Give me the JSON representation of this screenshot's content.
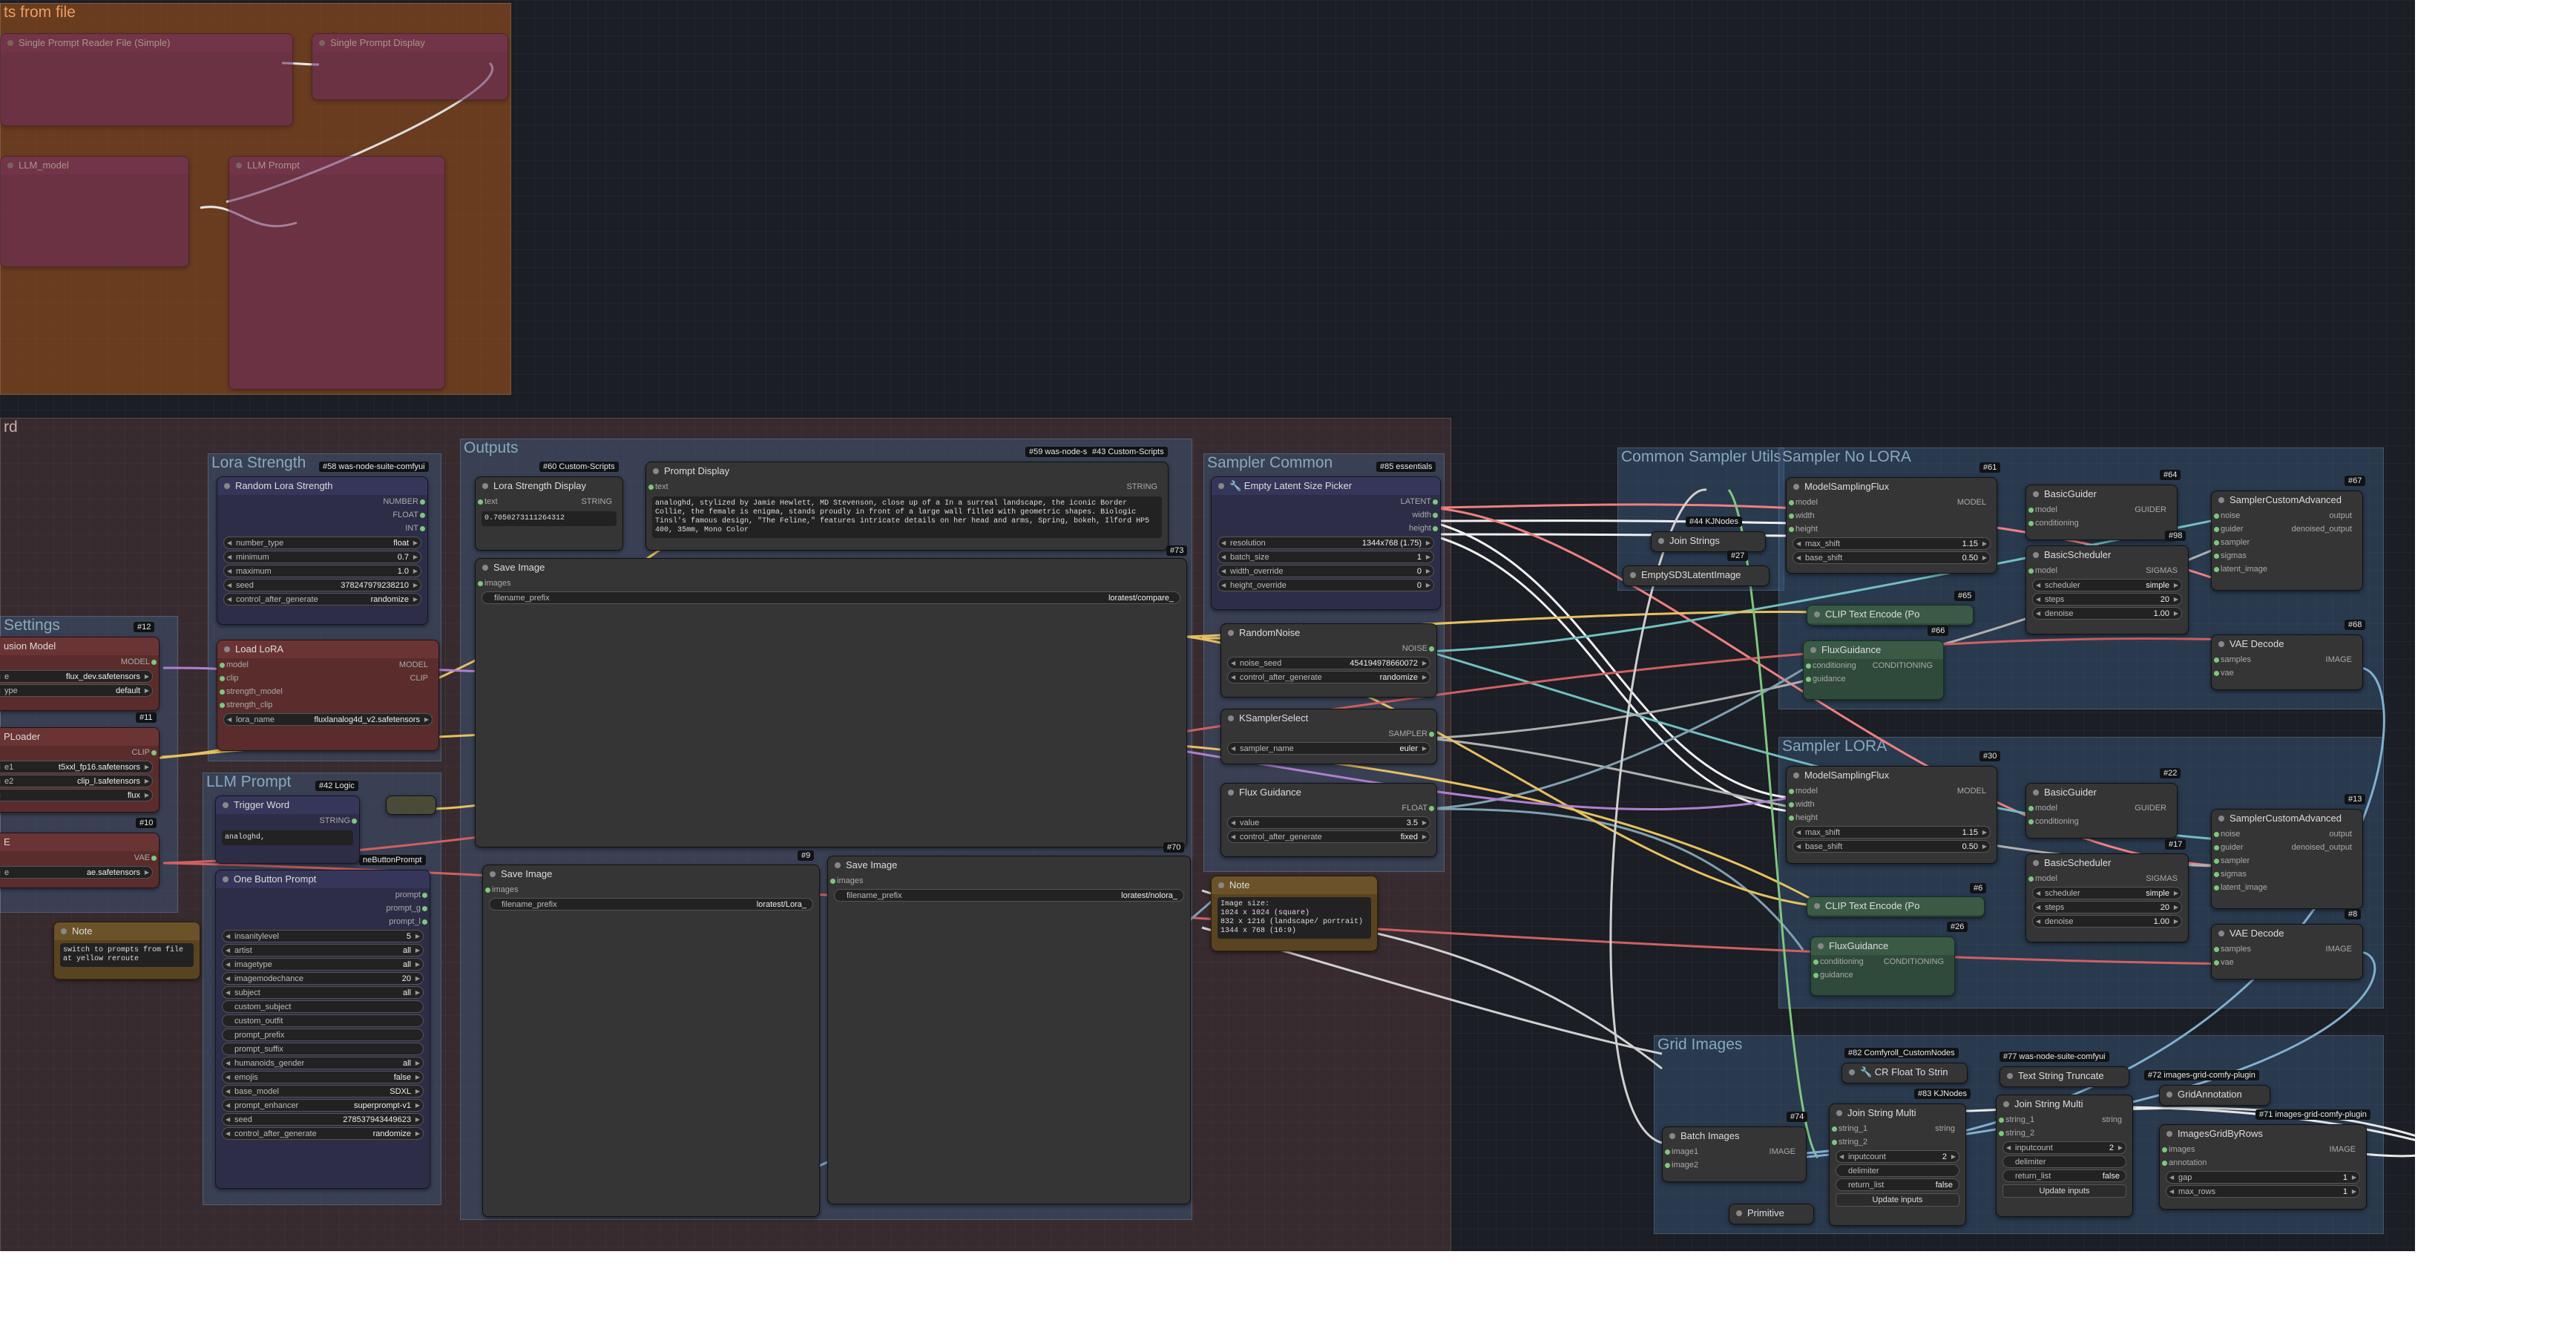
{
  "groups": {
    "prompts_file": "ts from file",
    "board": "rd",
    "lora_strength": "Lora Strength",
    "outputs": "Outputs",
    "sampler_common": "Sampler Common",
    "common_sampler_utils": "Common Sampler Utils",
    "sampler_no_lora": "Sampler No LORA",
    "sampler_lora": "Sampler LORA",
    "settings": "Settings",
    "llm_prompt": "LLM Prompt",
    "grid": "Grid Images"
  },
  "badges": {
    "b58": "#58 was-node-suite-comfyui",
    "b60": "#60 Custom-Scripts",
    "b59": "#59 was-node-s",
    "b43": "#43 Custom-Scripts",
    "b85": "#85 essentials",
    "b12": "#12",
    "b11": "#11",
    "b10": "#10",
    "b42": "#42 Logic",
    "b73": "#73",
    "b9": "#9",
    "b70": "#70",
    "b61": "#61",
    "b64": "#64",
    "b67": "#67",
    "b98": "#98",
    "b44": "#44 KJNodes",
    "b27": "#27",
    "b65": "#65",
    "b66": "#66",
    "b68": "#68",
    "b30": "#30",
    "b22": "#22",
    "b13": "#13",
    "b17": "#17",
    "b8": "#8",
    "b6": "#6",
    "b26": "#26",
    "b82": "#82 Comfyroll_CustomNodes",
    "b77": "#77 was-node-suite-comfyui",
    "b72": "#72 images-grid-comfy-plugin",
    "b83": "#83 KJNodes",
    "b71": "#71 images-grid-comfy-plugin",
    "b74": "#74"
  },
  "nodes": {
    "random_lora_strength": {
      "title": "Random Lora Strength",
      "outputs": [
        "NUMBER",
        "FLOAT",
        "INT"
      ],
      "widgets": [
        [
          "number_type",
          "float"
        ],
        [
          "minimum",
          "0.7"
        ],
        [
          "maximum",
          "1.0"
        ],
        [
          "seed",
          "378247979238210"
        ],
        [
          "control_after_generate",
          "randomize"
        ]
      ]
    },
    "load_lora": {
      "title": "Load LoRA",
      "inputs": [
        "model",
        "clip",
        "strength_model",
        "strength_clip"
      ],
      "outputs": [
        "MODEL",
        "CLIP"
      ],
      "widgets": [
        [
          "lora_name",
          "fluxlanalog4d_v2.safetensors"
        ]
      ]
    },
    "lora_strength_display": {
      "title": "Lora Strength Display",
      "input": "text",
      "output": "STRING",
      "value": "0.7050273111264312"
    },
    "prompt_display": {
      "title": "Prompt Display",
      "input": "text",
      "output": "STRING",
      "value": "analoghd, stylized by Jamie Hewlett, MD Stevenson, close up of a In a surreal landscape, the iconic Border Collie, the female is enigma, stands proudly in front of a large wall filled with geometric shapes. Biologic Tinsl's famous design, \"The Feline,\" features intricate details on her head and arms, Spring, bokeh, Ilford HP5 400, 35mm, Mono Color"
    },
    "save_image_top": {
      "title": "Save Image",
      "input": "images",
      "widget": [
        "filename_prefix",
        "loratest/compare_"
      ]
    },
    "save_image_left": {
      "title": "Save Image",
      "input": "images",
      "widget": [
        "filename_prefix",
        "loratest/Lora_"
      ]
    },
    "save_image_right": {
      "title": "Save Image",
      "input": "images",
      "widget": [
        "filename_prefix",
        "loratest/nolora_"
      ]
    },
    "empty_latent_picker": {
      "title": "🔧 Empty Latent Size Picker",
      "outputs": [
        "LATENT",
        "width",
        "height"
      ],
      "widgets": [
        [
          "resolution",
          "1344x768 (1.75)"
        ],
        [
          "batch_size",
          "1"
        ],
        [
          "width_override",
          "0"
        ],
        [
          "height_override",
          "0"
        ]
      ]
    },
    "random_noise": {
      "title": "RandomNoise",
      "output": "NOISE",
      "widgets": [
        [
          "noise_seed",
          "454194978660072"
        ],
        [
          "control_after_generate",
          "randomize"
        ]
      ]
    },
    "ksampler_select": {
      "title": "KSamplerSelect",
      "output": "SAMPLER",
      "widgets": [
        [
          "sampler_name",
          "euler"
        ]
      ]
    },
    "flux_guidance_float": {
      "title": "Flux Guidance",
      "output": "FLOAT",
      "widgets": [
        [
          "value",
          "3.5"
        ],
        [
          "control_after_generate",
          "fixed"
        ]
      ]
    },
    "note_sizes": {
      "title": "Note",
      "text": "Image size:\n1024 x 1024 (square)\n832 x 1216 (landscape/ portrait)\n1344 x 768 (16:9)"
    },
    "diffusion_model": {
      "title": "usion Model",
      "output": "MODEL",
      "widgets": [
        [
          "e",
          "flux_dev.safetensors"
        ],
        [
          "ype",
          "default"
        ]
      ]
    },
    "clip_loader": {
      "title": "PLoader",
      "output": "CLIP",
      "widgets": [
        [
          "e1",
          "t5xxl_fp16.safetensors"
        ],
        [
          "e2",
          "clip_l.safetensors"
        ],
        [
          "",
          "flux"
        ]
      ]
    },
    "vae_loader": {
      "title": "E",
      "output": "VAE",
      "widgets": [
        [
          "e",
          "ae.safetensors"
        ]
      ]
    },
    "trigger_word": {
      "title": "Trigger Word",
      "output": "STRING",
      "value": "analoghd,"
    },
    "obp_badge": "neButtonPrompt",
    "one_button_prompt": {
      "title": "One Button Prompt",
      "outputs": [
        "prompt",
        "prompt_g",
        "prompt_l"
      ],
      "widgets": [
        [
          "insanitylevel",
          "5"
        ],
        [
          "artist",
          "all"
        ],
        [
          "imagetype",
          "all"
        ],
        [
          "imagemodechance",
          "20"
        ],
        [
          "subject",
          "all"
        ]
      ],
      "texts": [
        "custom_subject",
        "custom_outfit",
        "prompt_prefix",
        "prompt_suffix"
      ],
      "widgets2": [
        [
          "humanoids_gender",
          "all"
        ],
        [
          "emojis",
          "false"
        ],
        [
          "base_model",
          "SDXL"
        ],
        [
          "prompt_enhancer",
          "superprompt-v1"
        ],
        [
          "seed",
          "278537943449623"
        ],
        [
          "control_after_generate",
          "randomize"
        ]
      ]
    },
    "note_switch": {
      "title": "Note",
      "text": "switch to prompts from file at yellow reroute"
    },
    "model_sampling_flux_1": {
      "title": "ModelSamplingFlux",
      "inputs": [
        "model",
        "width",
        "height"
      ],
      "output": "MODEL",
      "widgets": [
        [
          "max_shift",
          "1.15"
        ],
        [
          "base_shift",
          "0.50"
        ]
      ]
    },
    "basic_guider_1": {
      "title": "BasicGuider",
      "inputs": [
        "model",
        "conditioning"
      ],
      "output": "GUIDER"
    },
    "sampler_custom_adv_1": {
      "title": "SamplerCustomAdvanced",
      "inputs": [
        "noise",
        "guider",
        "sampler",
        "sigmas",
        "latent_image"
      ],
      "outputs": [
        "output",
        "denoised_output"
      ]
    },
    "basic_scheduler_1": {
      "title": "BasicScheduler",
      "input": "model",
      "output": "SIGMAS",
      "widgets": [
        [
          "scheduler",
          "simple"
        ],
        [
          "steps",
          "20"
        ],
        [
          "denoise",
          "1.00"
        ]
      ]
    },
    "join_strings": {
      "title": "Join Strings"
    },
    "empty_sd3": {
      "title": "EmptySD3LatentImage"
    },
    "clip_text_encode_1": {
      "title": "CLIP Text Encode (Po"
    },
    "flux_guidance_1": {
      "title": "FluxGuidance",
      "inputs": [
        "conditioning",
        "guidance"
      ],
      "output": "CONDITIONING"
    },
    "vae_decode_1": {
      "title": "VAE Decode",
      "inputs": [
        "samples",
        "vae"
      ],
      "output": "IMAGE"
    },
    "model_sampling_flux_2": {
      "title": "ModelSamplingFlux",
      "inputs": [
        "model",
        "width",
        "height"
      ],
      "output": "MODEL",
      "widgets": [
        [
          "max_shift",
          "1.15"
        ],
        [
          "base_shift",
          "0.50"
        ]
      ]
    },
    "basic_guider_2": {
      "title": "BasicGuider",
      "inputs": [
        "model",
        "conditioning"
      ],
      "output": "GUIDER"
    },
    "sampler_custom_adv_2": {
      "title": "SamplerCustomAdvanced",
      "inputs": [
        "noise",
        "guider",
        "sampler",
        "sigmas",
        "latent_image"
      ],
      "outputs": [
        "output",
        "denoised_output"
      ]
    },
    "basic_scheduler_2": {
      "title": "BasicScheduler",
      "input": "model",
      "output": "SIGMAS",
      "widgets": [
        [
          "scheduler",
          "simple"
        ],
        [
          "steps",
          "20"
        ],
        [
          "denoise",
          "1.00"
        ]
      ]
    },
    "clip_text_encode_2": {
      "title": "CLIP Text Encode (Po"
    },
    "flux_guidance_2": {
      "title": "FluxGuidance",
      "inputs": [
        "conditioning",
        "guidance"
      ],
      "output": "CONDITIONING"
    },
    "vae_decode_2": {
      "title": "VAE Decode",
      "inputs": [
        "samples",
        "vae"
      ],
      "output": "IMAGE"
    },
    "cr_float_to_string": {
      "title": "🔧 CR Float To Strin"
    },
    "text_string_truncate": {
      "title": "Text String Truncate"
    },
    "grid_annotation": {
      "title": "GridAnnotation",
      "output": "IMAGE"
    },
    "join_string_multi_1": {
      "title": "Join String Multi",
      "inputs": [
        "string_1",
        "string_2"
      ],
      "output": "string",
      "widgets": [
        [
          "inputcount",
          "2"
        ]
      ],
      "texts": [
        "delimiter"
      ],
      "widgets2": [
        [
          "return_list",
          "false"
        ]
      ],
      "button": "Update inputs"
    },
    "join_string_multi_2": {
      "title": "Join String Multi",
      "inputs": [
        "string_1",
        "string_2"
      ],
      "output": "string",
      "widgets": [
        [
          "inputcount",
          "2"
        ]
      ],
      "texts": [
        "delimiter"
      ],
      "widgets2": [
        [
          "return_list",
          "false"
        ]
      ],
      "button": "Update inputs"
    },
    "batch_images": {
      "title": "Batch Images",
      "inputs": [
        "image1",
        "image2"
      ],
      "output": "IMAGE"
    },
    "images_grid_by_rows": {
      "title": "ImagesGridByRows",
      "inputs": [
        "images",
        "annotation"
      ],
      "output": "IMAGE",
      "widgets": [
        [
          "gap",
          "1"
        ],
        [
          "max_rows",
          "1"
        ]
      ]
    },
    "primitive": {
      "title": "Primitive"
    },
    "llm_node_1": {
      "title": "LLM_model"
    },
    "llm_node_2": {
      "title": "LLM Prompt"
    },
    "spf_node": {
      "title": "Single Prompt Reader File (Simple)"
    },
    "spd_node": {
      "title": "Single Prompt Display"
    }
  }
}
